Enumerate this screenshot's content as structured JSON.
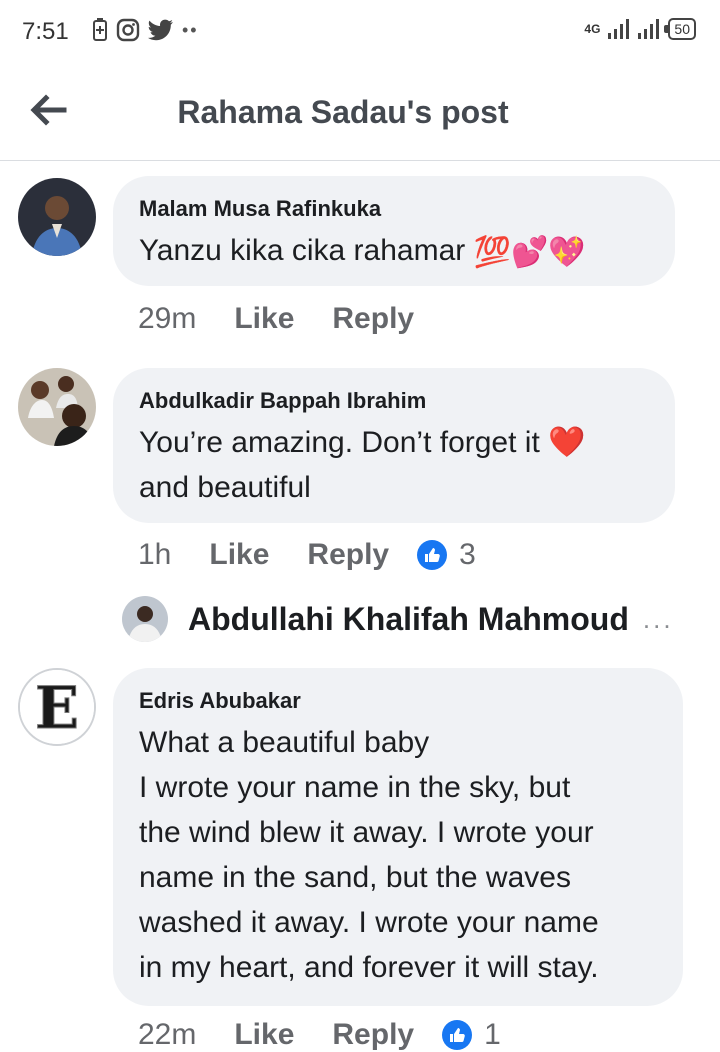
{
  "status": {
    "time": "7:51",
    "network": "4G",
    "battery": "50"
  },
  "header": {
    "title": "Rahama Sadau's post"
  },
  "comments": [
    {
      "author": "Malam Musa Rafinkuka",
      "text": "Yanzu kika cika rahamar",
      "emojis": "💯💕💖",
      "time": "29m",
      "like": "Like",
      "reply": "Reply"
    },
    {
      "author": "Abdulkadir Bappah Ibrahim",
      "text": "You’re amazing. Don’t forget it ❤️ and beautiful",
      "time": "1h",
      "like": "Like",
      "reply": "Reply",
      "reactions": "3"
    },
    {
      "author": "Edris Abubakar",
      "text_lines": [
        "What a beautiful baby",
        "I wrote your name in the sky, but",
        "the wind blew it away. I wrote your",
        "name in the sand, but the waves",
        "washed it away. I wrote your name",
        "in my heart, and forever it will stay."
      ],
      "time": "22m",
      "like": "Like",
      "reply": "Reply",
      "reactions": "1"
    }
  ],
  "reply_preview": {
    "author": "Abdullahi Khalifah Mahmoud",
    "more": "..."
  }
}
